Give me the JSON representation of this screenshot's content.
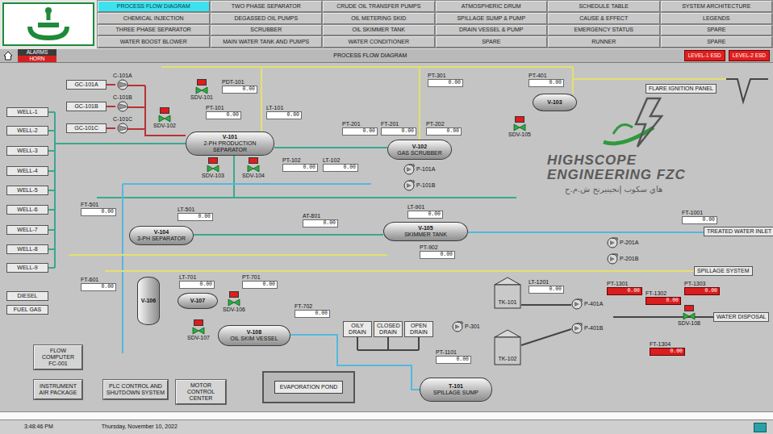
{
  "nav": [
    {
      "label": "PROCESS FLOW DIAGRAM",
      "selected": true
    },
    {
      "label": "TWO PHASE SEPARATOR",
      "selected": false
    },
    {
      "label": "CRUDE OIL TRANSFER PUMPS",
      "selected": false
    },
    {
      "label": "ATMOSPHERIC DRUM",
      "selected": false
    },
    {
      "label": "SCHEDULE TABLE",
      "selected": false
    },
    {
      "label": "SYSTEM ARCHITECTURE",
      "selected": false
    },
    {
      "label": "CHEMICAL INJECTION",
      "selected": false
    },
    {
      "label": "DEGASSED OIL PUMPS",
      "selected": false
    },
    {
      "label": "OIL METERING SKID",
      "selected": false
    },
    {
      "label": "SPILLAGE SUMP & PUMP",
      "selected": false
    },
    {
      "label": "CAUSE & EFFECT",
      "selected": false
    },
    {
      "label": "LEGENDS",
      "selected": false
    },
    {
      "label": "THREE PHASE SEPARATOR",
      "selected": false
    },
    {
      "label": "SCRUBBER",
      "selected": false
    },
    {
      "label": "OIL SKIMMER TANK",
      "selected": false
    },
    {
      "label": "DRAIN VESSEL & PUMP",
      "selected": false
    },
    {
      "label": "EMERGENCY STATUS",
      "selected": false
    },
    {
      "label": "SPARE",
      "selected": false
    },
    {
      "label": "WATER BOOST BLOWER",
      "selected": false
    },
    {
      "label": "MAIN WATER TANK AND PUMPS",
      "selected": false
    },
    {
      "label": "WATER CONDITIONER",
      "selected": false
    },
    {
      "label": "SPARE",
      "selected": false
    },
    {
      "label": "RUNNER",
      "selected": false
    },
    {
      "label": "SPARE",
      "selected": false
    }
  ],
  "header": {
    "alarm_top": "ALARMS",
    "alarm_bottom": "HORN",
    "title": "PROCESS FLOW DIAGRAM",
    "esd": [
      "LEVEL-1 ESD",
      "LEVEL-2 ESD"
    ]
  },
  "wells": [
    "WELL-1",
    "WELL-2",
    "WELL-3",
    "WELL-4",
    "WELL-5",
    "WELL-6",
    "WELL-7",
    "WELL-8",
    "WELL-9"
  ],
  "inlets": [
    "DIESEL",
    "FUEL GAS"
  ],
  "gas_lines": [
    "GC-101A",
    "GC-101B",
    "GC-101C"
  ],
  "compressors": [
    "C-101A",
    "C-101B",
    "C-101C"
  ],
  "vessels": [
    {
      "tag": "V-101",
      "desc": "2-PH PRODUCTION SEPARATOR"
    },
    {
      "tag": "V-102",
      "desc": "GAS SCRUBBER"
    },
    {
      "tag": "V-103"
    },
    {
      "tag": "V-104",
      "desc": "3-PH SEPARATOR"
    },
    {
      "tag": "V-105",
      "desc": "SKIMMER TANK"
    },
    {
      "tag": "V-106"
    },
    {
      "tag": "V-107"
    },
    {
      "tag": "V-108",
      "desc": "OIL SKIM VESSEL"
    },
    {
      "tag": "T-101",
      "desc": "SPILLAGE SUMP"
    }
  ],
  "tanks": [
    "TK-101",
    "TK-102"
  ],
  "pumps": [
    "P-101A",
    "P-101B",
    "P-201A",
    "P-201B",
    "P-301",
    "P-401A",
    "P-401B"
  ],
  "instruments": [
    {
      "tag": "PDT-101",
      "value": "0.00",
      "alarm": false
    },
    {
      "tag": "PT-101",
      "value": "0.00",
      "alarm": false
    },
    {
      "tag": "LT-101",
      "value": "0.00",
      "alarm": false
    },
    {
      "tag": "PT-102",
      "value": "0.00",
      "alarm": false
    },
    {
      "tag": "LT-102",
      "value": "0.00",
      "alarm": false
    },
    {
      "tag": "PT-201",
      "value": "0.00",
      "alarm": false
    },
    {
      "tag": "FT-201",
      "value": "0.00",
      "alarm": false
    },
    {
      "tag": "PT-202",
      "value": "0.00",
      "alarm": false
    },
    {
      "tag": "PT-301",
      "value": "0.00",
      "alarm": false
    },
    {
      "tag": "PT-401",
      "value": "0.00",
      "alarm": false
    },
    {
      "tag": "FT-501",
      "value": "0.00",
      "alarm": false
    },
    {
      "tag": "LT-501",
      "value": "0.00",
      "alarm": false
    },
    {
      "tag": "FT-601",
      "value": "0.00",
      "alarm": false
    },
    {
      "tag": "LT-701",
      "value": "0.00",
      "alarm": false
    },
    {
      "tag": "PT-701",
      "value": "0.00",
      "alarm": false
    },
    {
      "tag": "FT-702",
      "value": "0.00",
      "alarm": false
    },
    {
      "tag": "AT-801",
      "value": "0.00",
      "alarm": false
    },
    {
      "tag": "LT-901",
      "value": "0.00",
      "alarm": false
    },
    {
      "tag": "PT-902",
      "value": "0.00",
      "alarm": false
    },
    {
      "tag": "FT-1001",
      "value": "0.00",
      "alarm": false
    },
    {
      "tag": "PT-1101",
      "value": "0.00",
      "alarm": false
    },
    {
      "tag": "LT-1201",
      "value": "0.00",
      "alarm": false
    },
    {
      "tag": "PT-1301",
      "value": "0.00",
      "alarm": true
    },
    {
      "tag": "FT-1302",
      "value": "0.00",
      "alarm": true
    },
    {
      "tag": "PT-1303",
      "value": "0.00",
      "alarm": true
    },
    {
      "tag": "FT-1304",
      "value": "0.00",
      "alarm": true
    }
  ],
  "valves": [
    {
      "tag": "SDV-101",
      "tripped": true
    },
    {
      "tag": "SDV-102",
      "tripped": true
    },
    {
      "tag": "SDV-103",
      "tripped": true
    },
    {
      "tag": "SDV-104",
      "tripped": true
    },
    {
      "tag": "SDV-105",
      "tripped": true
    },
    {
      "tag": "SDV-106",
      "tripped": true
    },
    {
      "tag": "SDV-107",
      "tripped": true
    },
    {
      "tag": "SDV-108",
      "tripped": true
    }
  ],
  "streams": [
    "FLARE IGNITION PANEL",
    "TREATED WATER INLET",
    "SPILLAGE SYSTEM",
    "WATER DISPOSAL"
  ],
  "drains": [
    "OILY DRAIN",
    "CLOSED DRAIN",
    "OPEN DRAIN"
  ],
  "pond": "EVAPORATION POND",
  "panels": [
    "FLOW COMPUTER FC-001",
    "INSTRUMENT AIR PACKAGE",
    "PLC CONTROL AND SHUTDOWN SYSTEM",
    "MOTOR CONTROL CENTER"
  ],
  "watermark": {
    "line1": "HIGHSCOPE",
    "line2": "ENGINEERING FZC",
    "arabic": "هاي سكوب إنجينيرنج  ش.م.ح"
  },
  "status": {
    "time": "3:48:46 PM",
    "date": "Thursday, November 10, 2022"
  }
}
